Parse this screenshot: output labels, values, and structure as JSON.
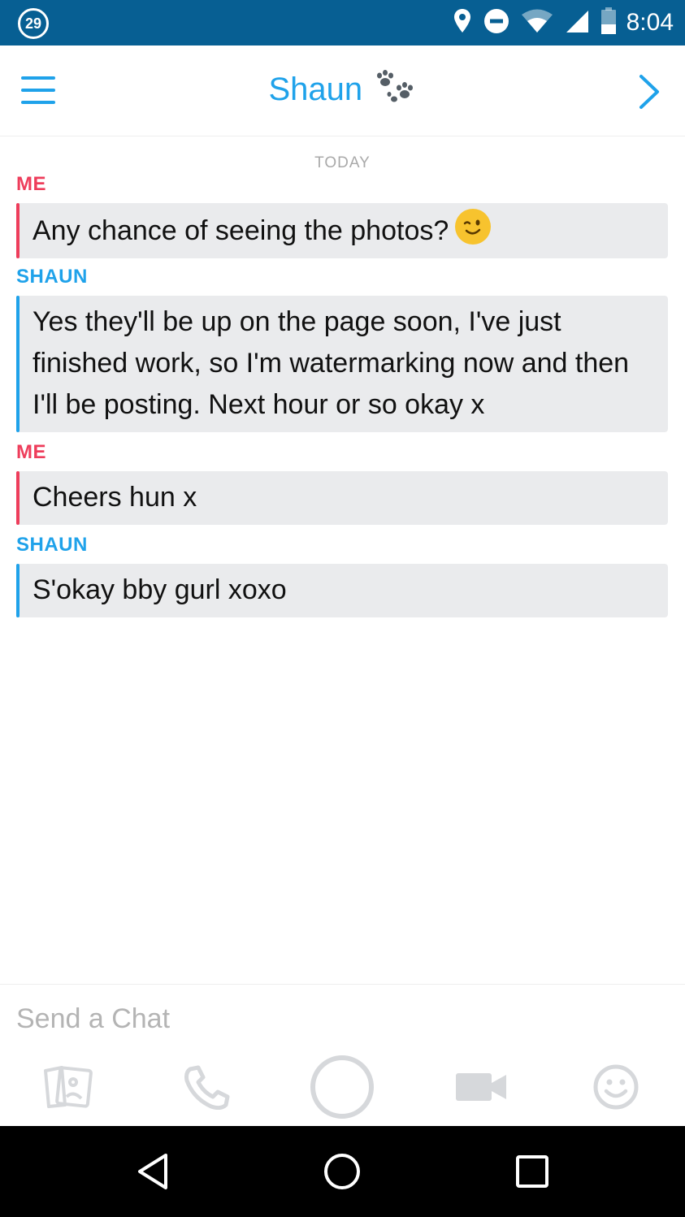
{
  "status_bar": {
    "notification_count": "29",
    "time": "8:04",
    "background": "#075f93",
    "icons": [
      "location-icon",
      "do-not-disturb-icon",
      "wifi-icon",
      "signal-icon",
      "battery-icon"
    ]
  },
  "header": {
    "title": "Shaun",
    "title_emoji_icon": "paw-prints-icon",
    "left_icon": "menu-icon",
    "right_icon": "chevron-right-icon",
    "accent_color": "#1fa2ea"
  },
  "chat": {
    "date_label": "TODAY",
    "messages": [
      {
        "sender": "ME",
        "from": "me",
        "text": "Any chance of seeing the photos?",
        "emoji": "winking-face-icon"
      },
      {
        "sender": "SHAUN",
        "from": "them",
        "text": "Yes they'll be up on the page soon, I've just finished work, so I'm watermarking now and then I'll be posting. Next hour or so okay x"
      },
      {
        "sender": "ME",
        "from": "me",
        "text": "Cheers hun x"
      },
      {
        "sender": "SHAUN",
        "from": "them",
        "text": "S'okay bby gurl xoxo"
      }
    ],
    "me_color": "#ee3d5b",
    "them_color": "#1fa2ea",
    "bubble_color": "#eaebed"
  },
  "compose": {
    "placeholder": "Send a Chat",
    "actions": [
      "memories-icon",
      "phone-icon",
      "capture-icon",
      "video-camera-icon",
      "smiley-icon"
    ]
  },
  "nav_bar": {
    "buttons": [
      "back-triangle-icon",
      "home-circle-icon",
      "recents-square-icon"
    ]
  }
}
